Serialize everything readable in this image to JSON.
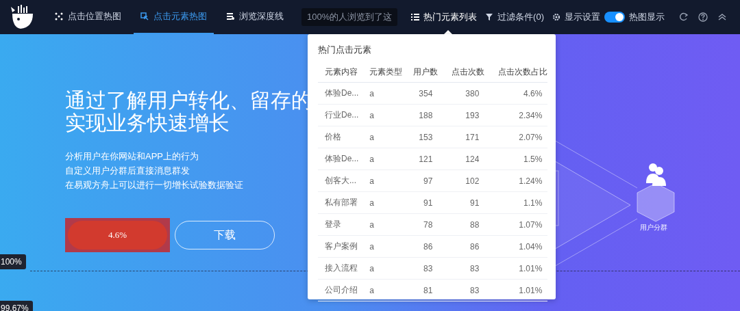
{
  "toolbar": {
    "tabs": [
      {
        "label": "点击位置热图",
        "selected": false
      },
      {
        "label": "点击元素热图",
        "selected": true
      },
      {
        "label": "浏览深度线",
        "selected": false
      }
    ],
    "depth_tip": "100%的人浏览到了这",
    "actions": [
      {
        "kind": "list",
        "label": "热门元素列表",
        "selected": true
      },
      {
        "kind": "filter",
        "label": "过滤条件(0)",
        "selected": false
      },
      {
        "kind": "settings",
        "label": "显示设置",
        "selected": false
      }
    ],
    "heatmap_toggle": {
      "label": "热图显示",
      "on": true
    }
  },
  "page": {
    "headline": [
      "通过了解用户转化、留存的",
      "实现业务快速增长"
    ],
    "description": [
      "分析用户在你网站和APP上的行为",
      "自定义用户分群后直接消息群发",
      "在易观方舟上可以进行一切增长试验数据验证"
    ],
    "buttons": [
      {
        "kind": "heat",
        "label": "4.6%"
      },
      {
        "kind": "outline",
        "label": "下载"
      }
    ],
    "illustration_label": "用户分群"
  },
  "depth_markers": [
    {
      "label": "100%"
    },
    {
      "label": "99.67%"
    }
  ],
  "popover": {
    "title": "热门点击元素",
    "columns": [
      "元素内容",
      "元素类型",
      "用户数",
      "点击次数",
      "点击次数占比"
    ],
    "rows": [
      [
        "体验De...",
        "a",
        "354",
        "380",
        "4.6%"
      ],
      [
        "行业De...",
        "a",
        "188",
        "193",
        "2.34%"
      ],
      [
        "价格",
        "a",
        "153",
        "171",
        "2.07%"
      ],
      [
        "体验De...",
        "a",
        "121",
        "124",
        "1.5%"
      ],
      [
        "创客大...",
        "a",
        "97",
        "102",
        "1.24%"
      ],
      [
        "私有部署",
        "a",
        "91",
        "91",
        "1.1%"
      ],
      [
        "登录",
        "a",
        "78",
        "88",
        "1.07%"
      ],
      [
        "客户案例",
        "a",
        "86",
        "86",
        "1.04%"
      ],
      [
        "接入流程",
        "a",
        "83",
        "83",
        "1.01%"
      ],
      [
        "公司介绍",
        "a",
        "81",
        "83",
        "1.01%"
      ]
    ]
  }
}
